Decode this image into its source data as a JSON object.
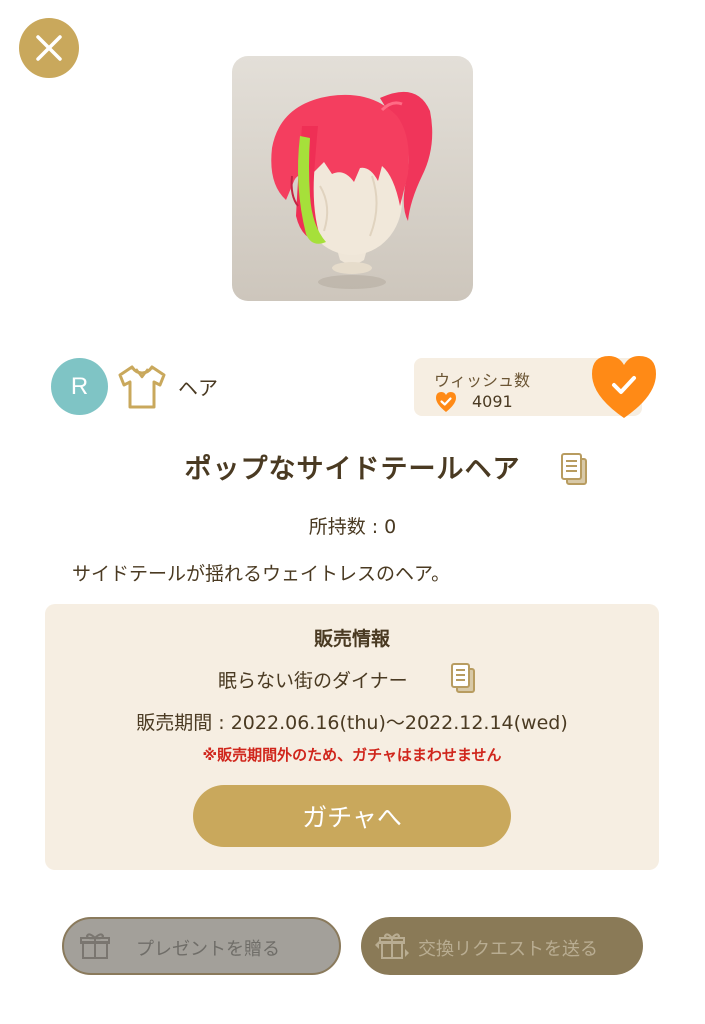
{
  "colors": {
    "accent_gold": "#c9a85c",
    "accent_orange": "#ff8a16",
    "rarity_teal": "#7fc4c5",
    "panel_beige": "#f6eee2",
    "warning_red": "#d0261c",
    "text_brown": "#4a3a22"
  },
  "close_button": {
    "icon": "close-icon"
  },
  "item": {
    "preview_icon": "hair-preview",
    "rarity": "R",
    "category_icon": "shirt-icon",
    "category": "ヘア",
    "name": "ポップなサイドテールヘア",
    "owned_text": "所持数 : 0",
    "description": "サイドテールが揺れるウェイトレスのヘア。"
  },
  "wish": {
    "title": "ウィッシュ数",
    "count": "4091",
    "icon": "heart-check-icon"
  },
  "sale": {
    "title": "販売情報",
    "gacha_name": "眠らない街のダイナー",
    "period": "販売期間 : 2022.06.16(thu)〜2022.12.14(wed)",
    "warning": "※販売期間外のため、ガチャはまわせません",
    "gacha_button": "ガチャへ"
  },
  "actions": {
    "present_label": "プレゼントを贈る",
    "exchange_label": "交換リクエストを送る"
  }
}
